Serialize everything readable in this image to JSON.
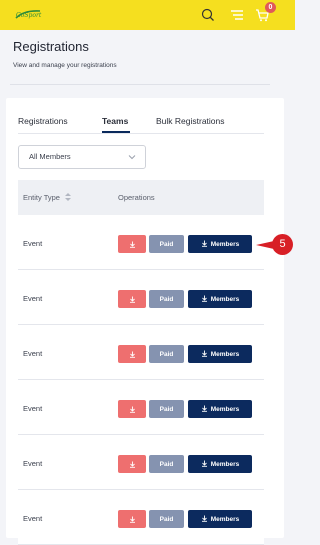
{
  "topbar": {
    "logo_text": "Go Sport",
    "cart_count": "0",
    "icons": [
      "search-icon",
      "menu-icon",
      "cart-icon"
    ],
    "colors": {
      "background": "#f5df1f",
      "badge": "#e05a5a"
    }
  },
  "header": {
    "title": "Registrations",
    "subtitle": "View and manage your registrations"
  },
  "tabs": [
    {
      "label": "Registrations",
      "active": false
    },
    {
      "label": "Teams",
      "active": true
    },
    {
      "label": "Bulk Registrations",
      "active": false
    }
  ],
  "filter": {
    "selected": "All Members"
  },
  "table": {
    "columns": [
      "Entity Type",
      "Operations"
    ],
    "rows": [
      {
        "entity_type": "Event",
        "paid_label": "Paid",
        "members_label": "Members"
      },
      {
        "entity_type": "Event",
        "paid_label": "Paid",
        "members_label": "Members"
      },
      {
        "entity_type": "Event",
        "paid_label": "Paid",
        "members_label": "Members"
      },
      {
        "entity_type": "Event",
        "paid_label": "Paid",
        "members_label": "Members"
      },
      {
        "entity_type": "Event",
        "paid_label": "Paid",
        "members_label": "Members"
      },
      {
        "entity_type": "Event",
        "paid_label": "Paid",
        "members_label": "Members"
      }
    ]
  },
  "annotation": {
    "step": "5",
    "color": "#d81f26"
  },
  "colors": {
    "download": "#ee6f6f",
    "paid": "#8593b0",
    "members": "#0c2a5e",
    "tab_underline": "#0a2a5c"
  }
}
